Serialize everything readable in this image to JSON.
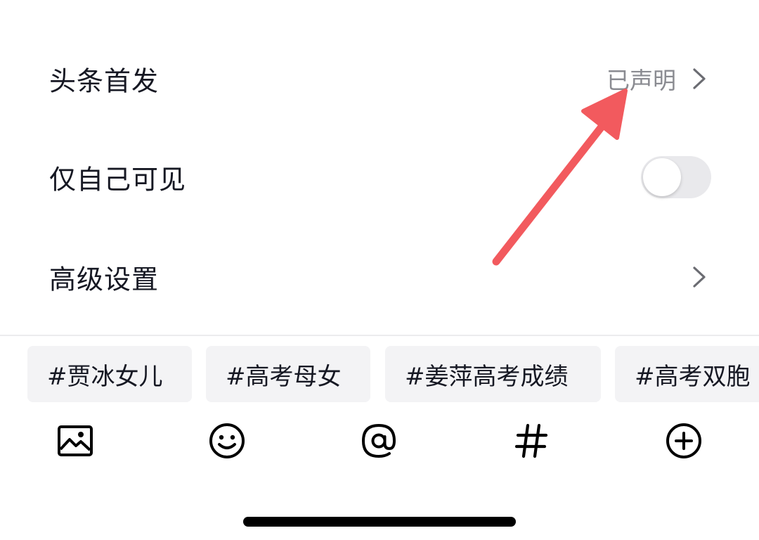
{
  "settings": {
    "first_publish": {
      "label": "头条首发",
      "value": "已声明"
    },
    "private": {
      "label": "仅自己可见",
      "enabled": false
    },
    "advanced": {
      "label": "高级设置"
    }
  },
  "topics": [
    "#贾冰女儿",
    "#高考母女",
    "#姜萍高考成绩",
    "#高考双胞"
  ],
  "toolbar": {
    "icons": [
      "image-icon",
      "emoji-icon",
      "mention-icon",
      "hashtag-icon",
      "add-icon"
    ]
  },
  "colors": {
    "annotation_arrow": "#f25a5e",
    "toggle_off": "#e9e9ec",
    "secondary_text": "#8a8b91",
    "chip_background": "#f3f3f5"
  }
}
